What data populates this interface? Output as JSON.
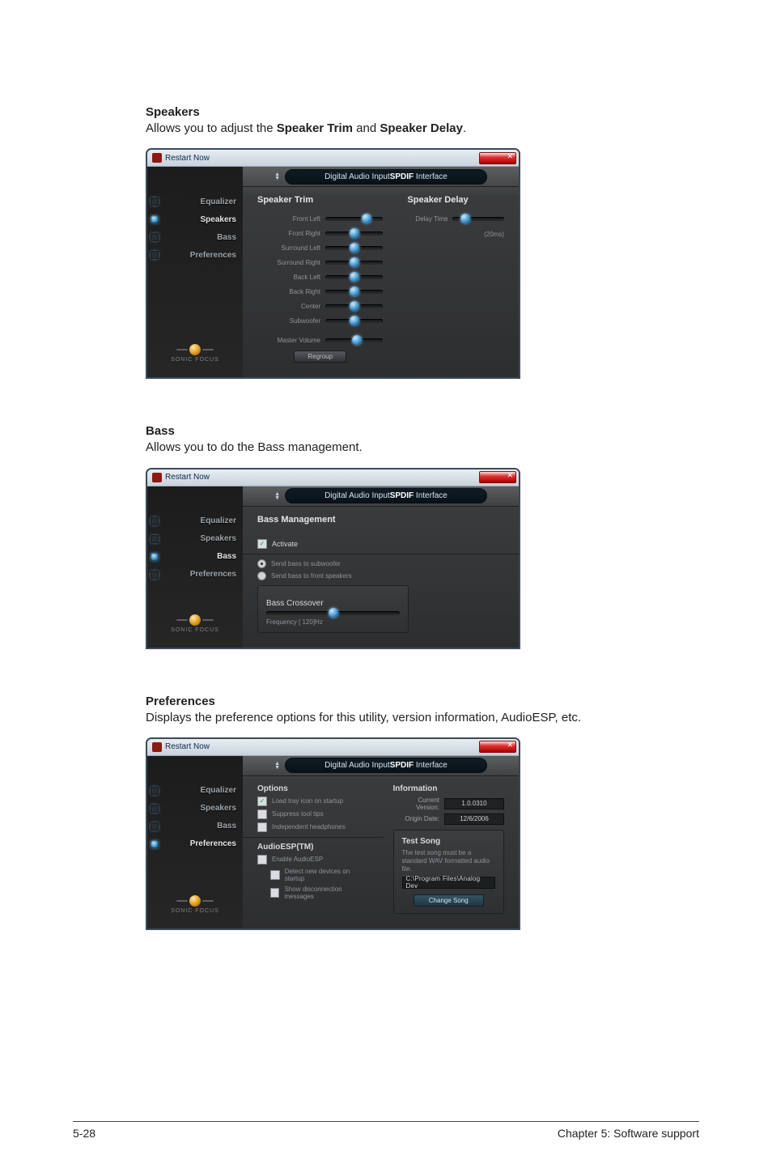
{
  "footer": {
    "left": "5-28",
    "right": "Chapter 5: Software support"
  },
  "speakers": {
    "heading": "Speakers",
    "desc_a": "Allows you to adjust the ",
    "desc_b1": "Speaker Trim",
    "desc_mid": " and ",
    "desc_b2": "Speaker Delay",
    "desc_end": ".",
    "window_title": "Restart Now",
    "tab_pre": "Digital Audio Input",
    "tab_bold": "SPDIF",
    "tab_post": " Interface",
    "sidebar": {
      "items": [
        "Equalizer",
        "Speakers",
        "Bass",
        "Preferences"
      ],
      "logo": "SONIC FOCUS"
    },
    "col1_title": "Speaker Trim",
    "col2_title": "Speaker Delay",
    "trim_labels": [
      "Front Left",
      "Front Right",
      "Surround Left",
      "Surround Right",
      "Back Left",
      "Back Right",
      "Center",
      "Subwoofer",
      "Master Volume"
    ],
    "delay_label": "Delay Time",
    "delay_unit": "(20ms)",
    "button": "Regroup"
  },
  "bass": {
    "heading": "Bass",
    "desc": "Allows you to do the Bass management.",
    "window_title": "Restart Now",
    "tab_pre": "Digital Audio Input",
    "tab_bold": "SPDIF",
    "tab_post": " Interface",
    "sidebar": {
      "items": [
        "Equalizer",
        "Speakers",
        "Bass",
        "Preferences"
      ],
      "logo": "SONIC FOCUS"
    },
    "panel_title": "Bass Management",
    "activate": "Activate",
    "radio1": "Send bass to subwoofer",
    "radio2": "Send bass to front speakers",
    "crossover_title": "Bass Crossover",
    "freq": "Frequency  [ 120]Hz"
  },
  "prefs": {
    "heading": "Preferences",
    "desc": "Displays the preference options for this utility, version information, AudioESP, etc.",
    "window_title": "Restart Now",
    "tab_pre": "Digital Audio Input",
    "tab_bold": "SPDIF",
    "tab_post": " Interface",
    "sidebar": {
      "items": [
        "Equalizer",
        "Speakers",
        "Bass",
        "Preferences"
      ],
      "logo": "SONIC FOCUS"
    },
    "options_title": "Options",
    "opt1": "Load tray icon on startup",
    "opt2": "Suppress tool tips",
    "opt3": "Independent headphones",
    "esp_title": "AudioESP(TM)",
    "esp1": "Enable AudioESP",
    "esp2": "Detect new devices on startup",
    "esp3": "Show disconnection messages",
    "info_title": "Information",
    "ver_label": "Current Version:",
    "ver_value": "1.0.0310",
    "date_label": "Origin Date:",
    "date_value": "12/6/2006",
    "test_title": "Test Song",
    "test_note": "The test song must be a standard WAV formatted audio file.",
    "test_path": "C:\\Program Files\\Analog Dev",
    "change_btn": "Change Song"
  }
}
